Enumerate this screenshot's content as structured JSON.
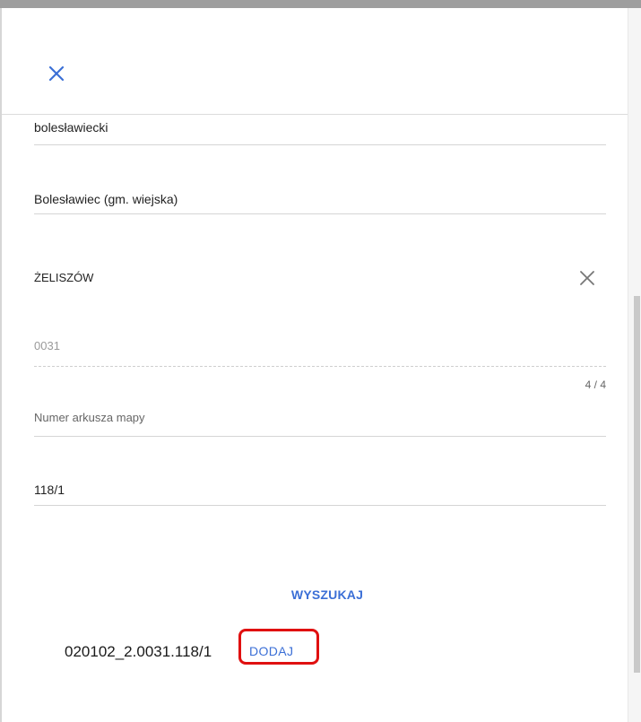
{
  "fields": {
    "county": "bolesławiecki",
    "commune": "Bolesławiec (gm. wiejska)",
    "precinct": "ŻELISZÓW",
    "precinct_number": "0031",
    "char_counter": "4 / 4",
    "map_sheet_placeholder": "Numer arkusza mapy",
    "parcel_number": "118/1"
  },
  "actions": {
    "search_label": "WYSZUKAJ",
    "add_label": "DODAJ"
  },
  "result": {
    "parcel_id": "020102_2.0031.118/1"
  },
  "colors": {
    "accent": "#3b6fd6",
    "highlight": "#e01010"
  },
  "icons": {
    "close": "close-icon",
    "clear": "clear-icon"
  }
}
